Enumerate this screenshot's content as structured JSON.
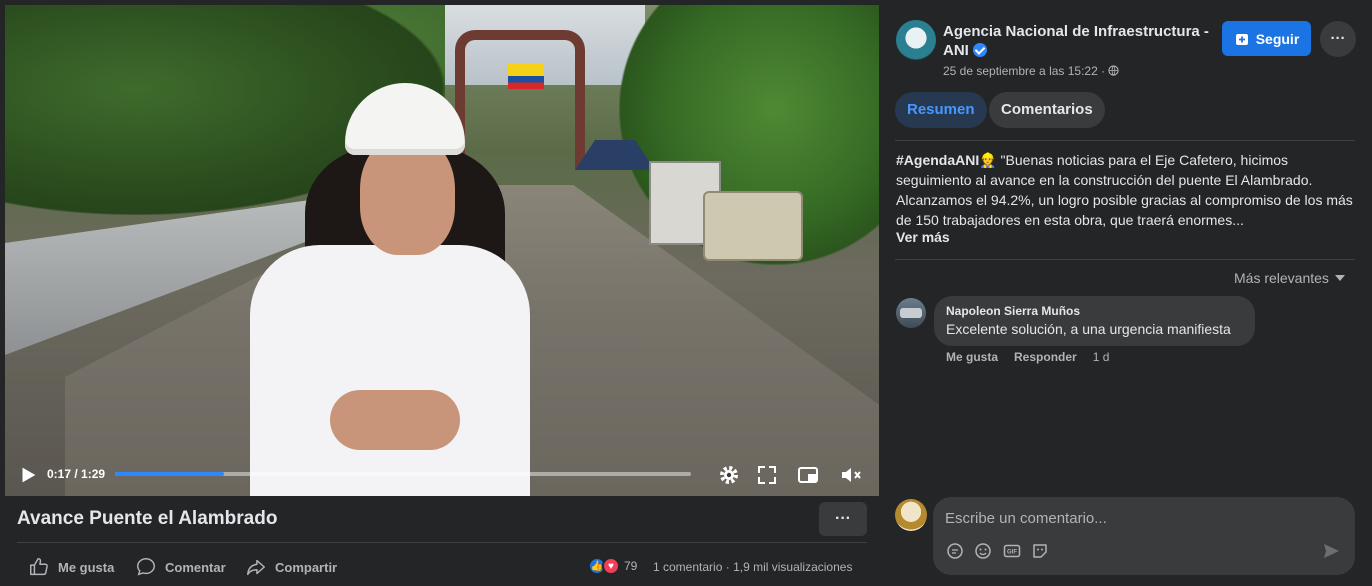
{
  "video": {
    "current_time": "0:17",
    "duration": "1:29",
    "time_display": "0:17 / 1:29",
    "progress_fraction": 0.19
  },
  "post": {
    "title": "Avance Puente el Alambrado",
    "more_label": "···",
    "actions": {
      "like": "Me gusta",
      "comment": "Comentar",
      "share": "Compartir"
    },
    "reaction_count": "79",
    "comment_count": "1 comentario",
    "views": "1,9 mil visualizaciones"
  },
  "page": {
    "name": "Agencia Nacional de Infraestructura - ANI",
    "date": "25 de septiembre a las 15:22 ·",
    "follow_label": "Seguir",
    "options_label": "···"
  },
  "tabs": {
    "summary": "Resumen",
    "comments": "Comentarios"
  },
  "description": {
    "hashtag": "#AgendaANI",
    "emoji": "👷",
    "text": " \"Buenas noticias para el Eje Cafetero, hicimos seguimiento al avance en la construcción del puente El Alambrado. Alcanzamos el 94.2%, un logro posible gracias al compromiso de los más de 150 trabajadores en esta obra, que traerá enormes...",
    "see_more": "Ver más"
  },
  "comments_section": {
    "sort_label": "Más relevantes",
    "items": [
      {
        "author": "Napoleon Sierra Muños",
        "text": "Excelente solución, a una urgencia manifiesta",
        "like": "Me gusta",
        "reply": "Responder",
        "age": "1 d"
      }
    ],
    "input_placeholder": "Escribe un comentario..."
  },
  "colors": {
    "accent": "#1b74e4",
    "background": "#242526",
    "bubble": "#3a3b3c",
    "progress": "#2d88ff",
    "like_reaction": "#1b74e4",
    "love_reaction": "#f33e58"
  }
}
